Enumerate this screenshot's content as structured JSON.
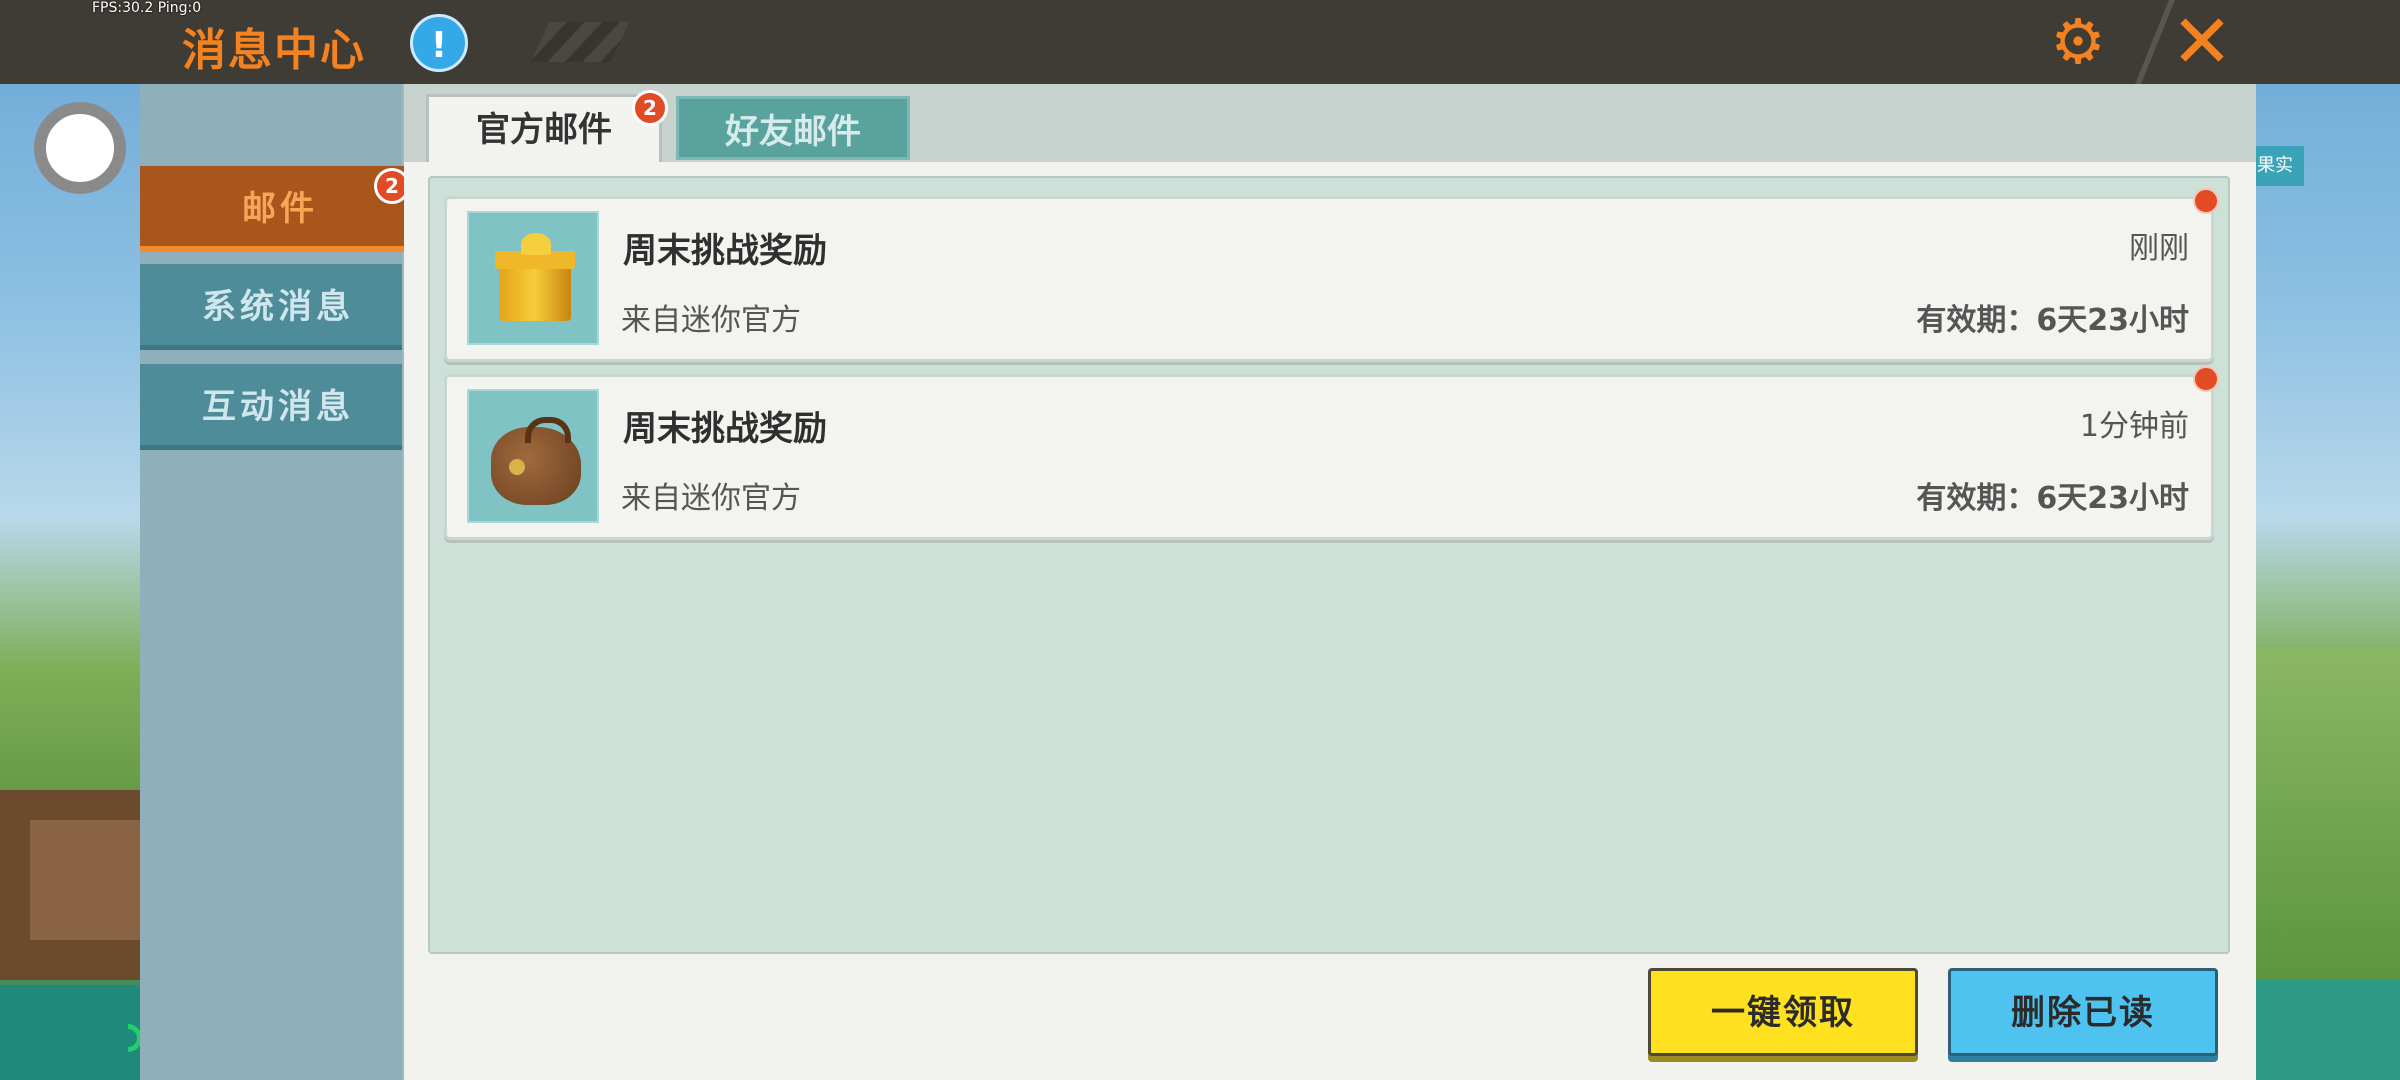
{
  "hud": {
    "fps_text": "FPS:30.2  Ping:0",
    "right_badge": "果实"
  },
  "header": {
    "title": "消息中心",
    "info_icon": "!",
    "icons": [
      "info-icon",
      "gear-icon",
      "close-icon"
    ]
  },
  "sidebar": {
    "items": [
      {
        "label": "邮件",
        "badge": "2",
        "active": true
      },
      {
        "label": "系统消息"
      },
      {
        "label": "互动消息"
      }
    ]
  },
  "tabs": [
    {
      "label": "官方邮件",
      "badge": "2",
      "active": true
    },
    {
      "label": "好友邮件"
    }
  ],
  "mails": [
    {
      "title": "周末挑战奖励",
      "from": "来自迷你官方",
      "time": "刚刚",
      "expire": "有效期：6天23小时",
      "icon": "gift-box-icon",
      "unread": true
    },
    {
      "title": "周末挑战奖励",
      "from": "来自迷你官方",
      "time": "1分钟前",
      "expire": "有效期：6天23小时",
      "icon": "leather-bag-icon",
      "unread": true
    }
  ],
  "actions": {
    "collect_all": "一键领取",
    "delete_read": "删除已读"
  },
  "colors": {
    "accent_orange": "#f5811f",
    "collect_yellow": "#ffe11f",
    "delete_blue": "#4fc3f0",
    "unread_red": "#e14b25"
  }
}
